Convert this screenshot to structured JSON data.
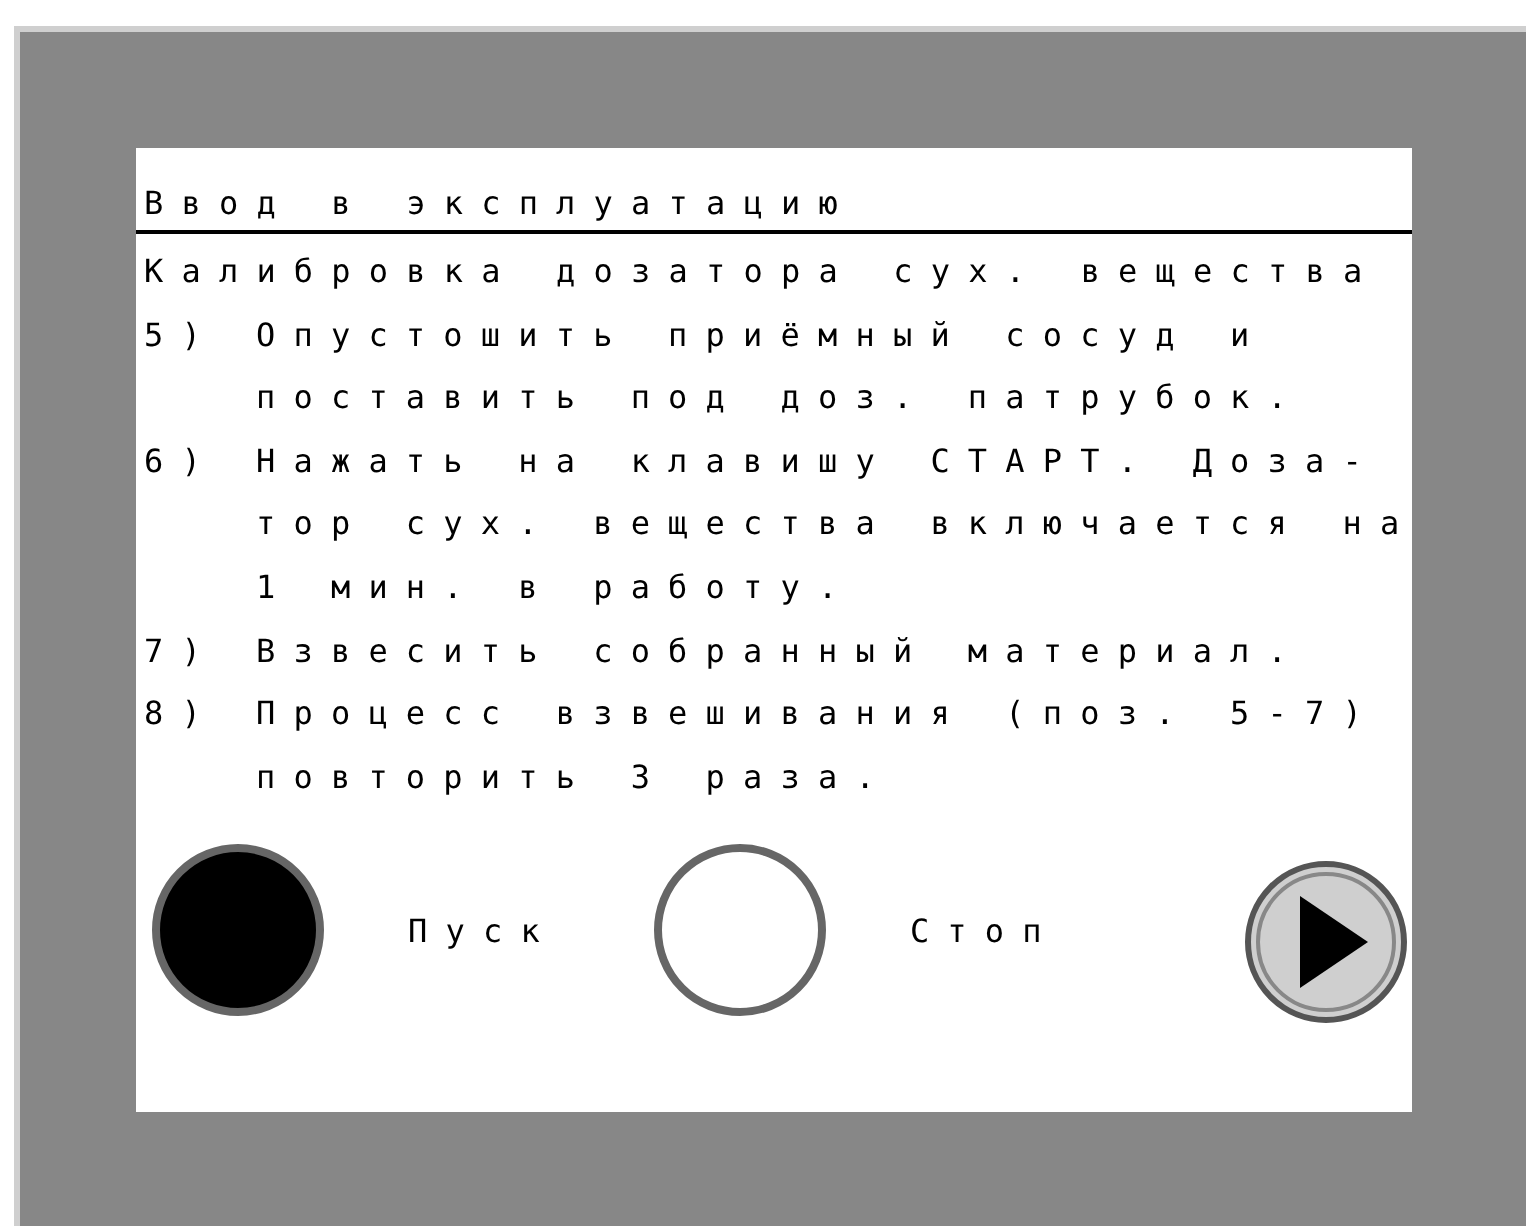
{
  "title": "Ввод в эксплуатацию",
  "heading": "Калибровка дозатора сух. вещества",
  "steps": [
    {
      "number": "5)",
      "lines": [
        "Опустошить приёмный сосуд и",
        "поставить под доз. патрубок."
      ]
    },
    {
      "number": "6)",
      "lines": [
        "Нажать на клавишу СТАРТ. Доза-",
        "тор сух. вещества включается на",
        "1 мин. в работу."
      ]
    },
    {
      "number": "7)",
      "lines": [
        "Взвесить собранный материал."
      ]
    },
    {
      "number": "8)",
      "lines": [
        "Процесс взвешивания (поз. 5-7)",
        "повторить 3 раза."
      ]
    }
  ],
  "indicators": [
    {
      "label": "Пуск",
      "on": true
    },
    {
      "label": "Стоп",
      "on": false
    }
  ]
}
